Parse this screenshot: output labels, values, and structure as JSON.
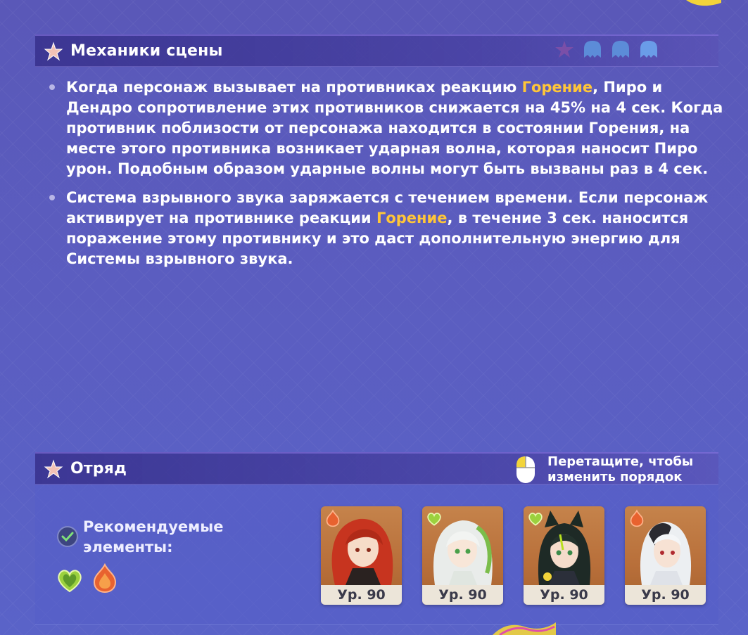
{
  "mechanics": {
    "title": "Механики сцены",
    "bullets": [
      {
        "before": "Когда персонаж вызывает на противниках реакцию ",
        "highlight": "Горение",
        "after": ", Пиро и Дендро сопротивление этих противников снижается на 45% на 4 сек. Когда противник поблизости от персонажа находится в состоянии Горения, на месте этого противника возникает ударная волна, которая наносит Пиро урон. Подобным образом ударные волны могут быть вызваны раз в 4 сек."
      },
      {
        "before": "Система взрывного звука заряжается с течением времени. Если персонаж активирует на противнике реакции ",
        "highlight": "Горение",
        "after": ", в течение 3 сек. наносится поражение этому противнику и это даст дополнительную энергию для Системы взрывного звука."
      }
    ]
  },
  "squad": {
    "title": "Отряд",
    "drag_hint": [
      "Перетащите, чтобы",
      "изменить порядок"
    ],
    "recommended_label": [
      "Рекомендуемые",
      "элементы:"
    ],
    "recommended_elements": [
      "dendro-icon",
      "pyro-icon"
    ],
    "characters": [
      {
        "element": "pyro-icon",
        "level": "Ур. 90"
      },
      {
        "element": "dendro-icon",
        "level": "Ур. 90"
      },
      {
        "element": "dendro-icon",
        "level": "Ур. 90"
      },
      {
        "element": "pyro-icon",
        "level": "Ур. 90"
      }
    ]
  },
  "colors": {
    "highlight": "#ffc638",
    "pyro": "#e8622f",
    "dendro": "#9bd13e",
    "card_bg": "#b8723c"
  }
}
